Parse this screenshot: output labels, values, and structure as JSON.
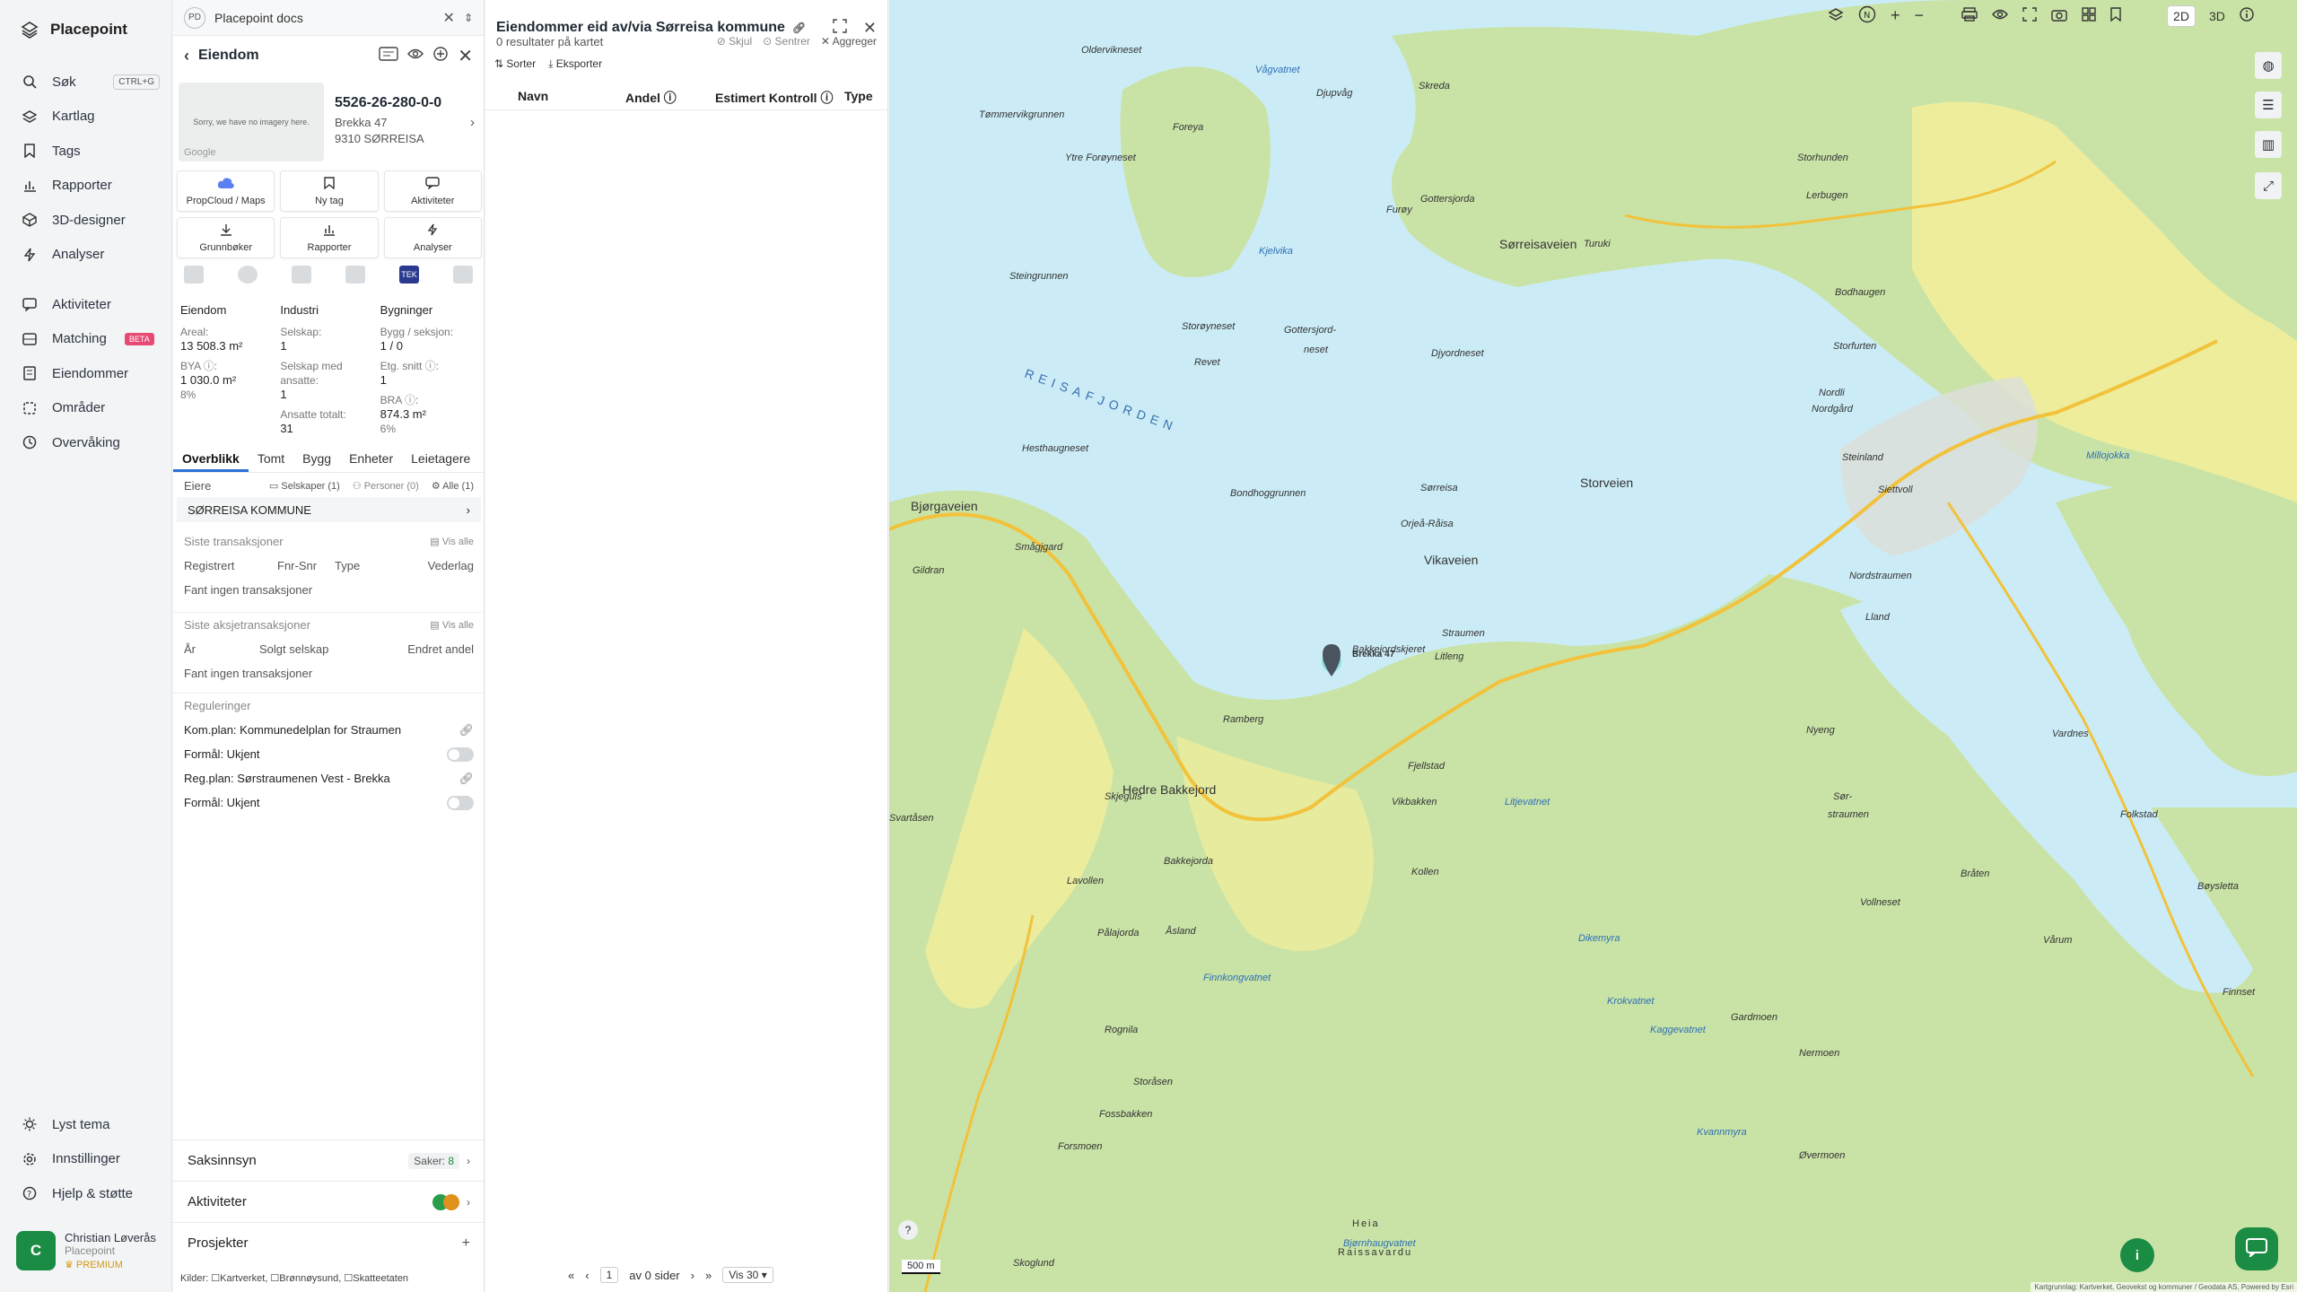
{
  "nav": {
    "brand": "Placepoint",
    "items": [
      {
        "label": "Søk",
        "icon": "search-icon",
        "kbd": "CTRL+G"
      },
      {
        "label": "Kartlag",
        "icon": "layers-icon"
      },
      {
        "label": "Tags",
        "icon": "bookmark-icon"
      },
      {
        "label": "Rapporter",
        "icon": "bar-chart-icon"
      },
      {
        "label": "3D-designer",
        "icon": "cube-icon"
      },
      {
        "label": "Analyser",
        "icon": "bolt-icon"
      }
    ],
    "items2": [
      {
        "label": "Aktiviteter",
        "icon": "chat-icon"
      },
      {
        "label": "Matching",
        "icon": "grid-icon",
        "badge": "BETA"
      },
      {
        "label": "Eiendommer",
        "icon": "building-icon"
      },
      {
        "label": "Områder",
        "icon": "area-icon"
      },
      {
        "label": "Overvåking",
        "icon": "watch-icon"
      }
    ],
    "bottom": [
      {
        "label": "Lyst tema",
        "icon": "sun-icon"
      },
      {
        "label": "Innstillinger",
        "icon": "gear-icon"
      },
      {
        "label": "Hjelp & støtte",
        "icon": "help-icon"
      }
    ],
    "user": {
      "initial": "C",
      "name": "Christian Løverås",
      "org": "Placepoint",
      "tier": "PREMIUM"
    }
  },
  "prop": {
    "workspace": "Placepoint docs",
    "workspace_badge": "PD",
    "title": "Eiendom",
    "thumb_text": "Sorry, we have no imagery here.",
    "thumb_google": "Google",
    "id": "5526-26-280-0-0",
    "addr1": "Brekka 47",
    "addr2": "9310 SØRREISA",
    "buttons": [
      {
        "label": "PropCloud / Maps",
        "icon": "cloud-icon"
      },
      {
        "label": "Ny tag",
        "icon": "bookmark-icon"
      },
      {
        "label": "Aktiviteter",
        "icon": "chat-icon"
      },
      {
        "label": "Grunnbøker",
        "icon": "download-icon"
      },
      {
        "label": "Rapporter",
        "icon": "bar-chart-icon"
      },
      {
        "label": "Analyser",
        "icon": "bolt-icon"
      }
    ],
    "strip_tek": "TEK",
    "stats": {
      "col1_title": "Eiendom",
      "areal_l": "Areal:",
      "areal": "13 508.3 m²",
      "bya_l": "BYA ⓘ:",
      "bya": "1 030.0 m²",
      "bya_p": "8%",
      "col2_title": "Industri",
      "selskap_l": "Selskap:",
      "selskap": "1",
      "sma_l": "Selskap med ansatte:",
      "sma": "1",
      "ans_l": "Ansatte totalt:",
      "ans": "31",
      "col3_title": "Bygninger",
      "bygg_l": "Bygg / seksjon:",
      "bygg": "1 / 0",
      "etg_l": "Etg. snitt ⓘ:",
      "etg": "1",
      "bra_l": "BRA ⓘ:",
      "bra": "874.3 m²",
      "bra_p": "6%"
    },
    "tabs": [
      "Overblikk",
      "Tomt",
      "Bygg",
      "Enheter",
      "Leietagere"
    ],
    "eiere": "Eiere",
    "eiere_selskaper": "Selskaper (1)",
    "eiere_personer": "Personer (0)",
    "eiere_alle": "Alle (1)",
    "owner": "SØRREISA KOMMUNE",
    "trans_title": "Siste transaksjoner",
    "vis_alle": "Vis alle",
    "trans_cols": [
      "Registrert",
      "Fnr-Snr",
      "Type",
      "Vederlag"
    ],
    "trans_empty": "Fant ingen transaksjoner",
    "aksje_title": "Siste aksjetransaksjoner",
    "aksje_cols": [
      "År",
      "Solgt selskap",
      "Endret andel"
    ],
    "aksje_empty": "Fant ingen transaksjoner",
    "reg_title": "Reguleringer",
    "reg": [
      {
        "label": "Kom.plan: Kommunedelplan for Straumen",
        "kind": "link"
      },
      {
        "label": "Formål: Ukjent",
        "kind": "toggle"
      },
      {
        "label": "Reg.plan: Sørstraumenen Vest - Brekka",
        "kind": "link"
      },
      {
        "label": "Formål: Ukjent",
        "kind": "toggle"
      }
    ],
    "bottom": {
      "saksinnsyn": "Saksinnsyn",
      "saker_l": "Saker:",
      "saker": "8",
      "aktiviteter": "Aktiviteter",
      "prosjekter": "Prosjekter"
    },
    "kilder": "Kilder:",
    "kilder_items": [
      "Kartverket,",
      "Brønnøysund,",
      "Skatteetaten"
    ]
  },
  "res": {
    "title": "Eiendommer eid av/via Sørreisa kommune",
    "count": "0 resultater på kartet",
    "skjul": "Skjul",
    "sentrer": "Sentrer",
    "aggreger": "Aggreger",
    "sorter": "Sorter",
    "eksporter": "Eksporter",
    "cols": [
      "Navn",
      "Andel ⓘ",
      "Estimert Kontroll ⓘ",
      "Type"
    ],
    "page": "1",
    "av": "av 0 sider",
    "vis": "Vis 30"
  },
  "map": {
    "mode2d": "2D",
    "mode3d": "3D",
    "scale": "500 m",
    "attribution": "Kartgrunnlag: Kartverket, Geovekst og kommuner / Geodata AS, Powered by Esri",
    "labels": [
      {
        "t": "Oldervikneset"
      },
      {
        "t": "Vågvatnet"
      },
      {
        "t": "Djupvåg"
      },
      {
        "t": "Skreda"
      },
      {
        "t": "Tømmervikgrunnen"
      },
      {
        "t": "Foreya"
      },
      {
        "t": "Ytre Forøyneset"
      },
      {
        "t": "Storhunden"
      },
      {
        "t": "Furøy"
      },
      {
        "t": "Gottersjorda"
      },
      {
        "t": "Sørreisaveien"
      },
      {
        "t": "Kjelvika"
      },
      {
        "t": "Steingrunnen"
      },
      {
        "t": "Storøyneset"
      },
      {
        "t": "Gottersjord-"
      },
      {
        "t": "neset"
      },
      {
        "t": "REISAFJORDEN"
      },
      {
        "t": "Revet"
      },
      {
        "t": "Djyordneset"
      },
      {
        "t": "Hesthaugneset"
      },
      {
        "t": "Bondhoggrunnen"
      },
      {
        "t": "Sørreisa"
      },
      {
        "t": "Orjeå-Råisa"
      },
      {
        "t": "Vikaveien"
      },
      {
        "t": "Bjørgaveien"
      },
      {
        "t": "Smågjgard"
      },
      {
        "t": "Gildran"
      },
      {
        "t": "Storveien"
      },
      {
        "t": "Bakkejordskjeret"
      },
      {
        "t": "Straumen"
      },
      {
        "t": "Litleng"
      },
      {
        "t": "Ramberg"
      },
      {
        "t": "Hedre Bakkejord"
      },
      {
        "t": "Fjellstad"
      },
      {
        "t": "Vikbakken"
      },
      {
        "t": "Skjeguls"
      },
      {
        "t": "Bakkejorda"
      },
      {
        "t": "Kollen"
      },
      {
        "t": "Lavollen"
      },
      {
        "t": "Åsland"
      },
      {
        "t": "Pålajorda"
      },
      {
        "t": "Dikemyra"
      },
      {
        "t": "Finnkongvatnet"
      },
      {
        "t": "Krokvatnet"
      },
      {
        "t": "Kaggevatnet"
      },
      {
        "t": "Rognila"
      },
      {
        "t": "Storåsen"
      },
      {
        "t": "Fossbakken"
      },
      {
        "t": "Forsmoen"
      },
      {
        "t": "Skoglund"
      },
      {
        "t": "Heia"
      },
      {
        "t": "Raissavardu"
      },
      {
        "t": "Bjørnhaugvatnet"
      },
      {
        "t": "Kvannmyra"
      },
      {
        "t": "Gardmoen"
      },
      {
        "t": "Nermoen"
      },
      {
        "t": "Vollneset"
      },
      {
        "t": "Bøysletta"
      },
      {
        "t": "Finnset"
      },
      {
        "t": "Øvermoen"
      },
      {
        "t": "Brekka 47"
      },
      {
        "t": "Lerbugen"
      },
      {
        "t": "Storfurten"
      },
      {
        "t": "Nordgård"
      },
      {
        "t": "Steinland"
      },
      {
        "t": "Siettvoll"
      },
      {
        "t": "Nordstraumen"
      },
      {
        "t": "Lland"
      },
      {
        "t": "Nyeng"
      },
      {
        "t": "Vardnes"
      },
      {
        "t": "Folkstad"
      },
      {
        "t": "Sør-"
      },
      {
        "t": "straumen"
      },
      {
        "t": "Bråten"
      },
      {
        "t": "Vårum"
      },
      {
        "t": "Bodhaugen"
      },
      {
        "t": "Nordli"
      },
      {
        "t": "Millojokka"
      },
      {
        "t": "Svartåsen"
      },
      {
        "t": "Litjevatnet"
      },
      {
        "t": "Turuki"
      }
    ]
  }
}
